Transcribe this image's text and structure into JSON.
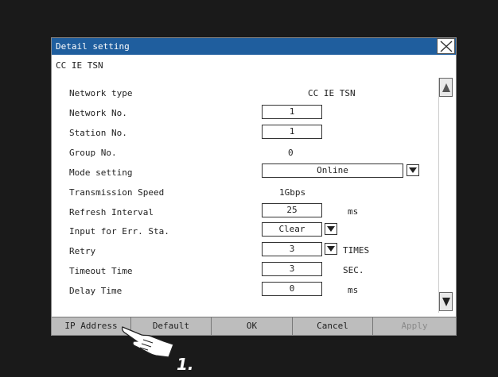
{
  "dialog": {
    "title": "Detail setting",
    "section": "CC IE TSN",
    "rows": {
      "network_type": {
        "label": "Network type",
        "value": "CC IE TSN"
      },
      "network_no": {
        "label": "Network No.",
        "value": "1"
      },
      "station_no": {
        "label": "Station No.",
        "value": "1"
      },
      "group_no": {
        "label": "Group No.",
        "value": "0"
      },
      "mode_setting": {
        "label": "Mode setting",
        "value": "Online"
      },
      "transmission_speed": {
        "label": "Transmission Speed",
        "value": "1Gbps"
      },
      "refresh_interval": {
        "label": "Refresh Interval",
        "value": "25",
        "unit": "ms"
      },
      "input_err_sta": {
        "label": "Input for Err. Sta.",
        "value": "Clear"
      },
      "retry": {
        "label": "Retry",
        "value": "3",
        "unit": "TIMES"
      },
      "timeout_time": {
        "label": "Timeout Time",
        "value": "3",
        "unit": "SEC."
      },
      "delay_time": {
        "label": "Delay Time",
        "value": "0",
        "unit": "ms"
      }
    },
    "buttons": {
      "ip_address": "IP Address",
      "default": "Default",
      "ok": "OK",
      "cancel": "Cancel",
      "apply": "Apply"
    }
  },
  "annotation": {
    "step": "1."
  },
  "icons": {
    "close": "close-icon",
    "dropdown": "triangle-down-icon",
    "scroll_up": "arrow-up-icon",
    "scroll_down": "arrow-down-icon",
    "pointer": "hand-pointer-icon"
  },
  "colors": {
    "titlebar": "#1f5e9e",
    "button_bar": "#bdbdbd",
    "background": "#1a1a1a"
  }
}
